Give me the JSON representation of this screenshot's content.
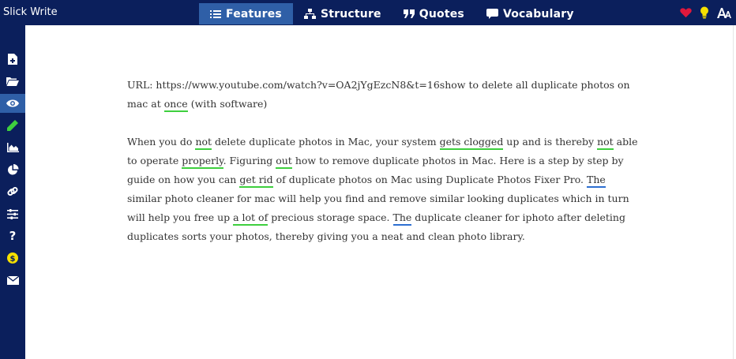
{
  "app": {
    "title": "Slick Write"
  },
  "tabs": [
    {
      "label": "Features",
      "icon": "list-icon",
      "active": true
    },
    {
      "label": "Structure",
      "icon": "sitemap-icon",
      "active": false
    },
    {
      "label": "Quotes",
      "icon": "quote-icon",
      "active": false
    },
    {
      "label": "Vocabulary",
      "icon": "comment-icon",
      "active": false
    }
  ],
  "top_icons": [
    "heart-icon",
    "lightbulb-icon",
    "font-size-icon"
  ],
  "sidebar": [
    {
      "icon": "new-document-icon",
      "active": false
    },
    {
      "icon": "open-folder-icon",
      "active": false
    },
    {
      "icon": "eye-icon",
      "active": true
    },
    {
      "icon": "pencil-icon",
      "active": false
    },
    {
      "icon": "area-chart-icon",
      "active": false
    },
    {
      "icon": "pie-chart-icon",
      "active": false
    },
    {
      "icon": "link-icon",
      "active": false
    },
    {
      "icon": "sliders-icon",
      "active": false
    },
    {
      "icon": "help-icon",
      "active": false
    },
    {
      "icon": "dollar-icon",
      "active": false
    },
    {
      "icon": "mail-icon",
      "active": false
    }
  ],
  "colors": {
    "navy": "#0b1f5c",
    "active_tab": "#2f5fa7",
    "green_underline": "#3ecf3e",
    "blue_underline": "#2d6fd1",
    "heart": "#e0183c",
    "bulb": "#f6e000"
  },
  "doc": {
    "p1": [
      "URL: https://www.youtube.com/watch?v=OA2jYgEzcN8&t=16show to delete all duplicate photos on mac at ",
      "once",
      " (with software)"
    ],
    "p2": [
      "When you do ",
      "not",
      " delete duplicate photos in Mac, your system ",
      "gets clogged",
      " up and is thereby ",
      "not",
      " able to operate ",
      "properly",
      ". Figuring ",
      "out",
      " how to remove duplicate photos in Mac. Here is a step by step by guide on how you can ",
      "get rid",
      " of duplicate photos on Mac using Duplicate Photos Fixer Pro.  ",
      "The",
      " similar photo cleaner for mac will help you find and remove similar looking duplicates which in turn will help you free up ",
      "a lot of",
      " precious storage space. ",
      "The",
      " duplicate cleaner for iphoto after deleting duplicates sorts your photos, thereby giving you a neat and clean photo library."
    ]
  }
}
